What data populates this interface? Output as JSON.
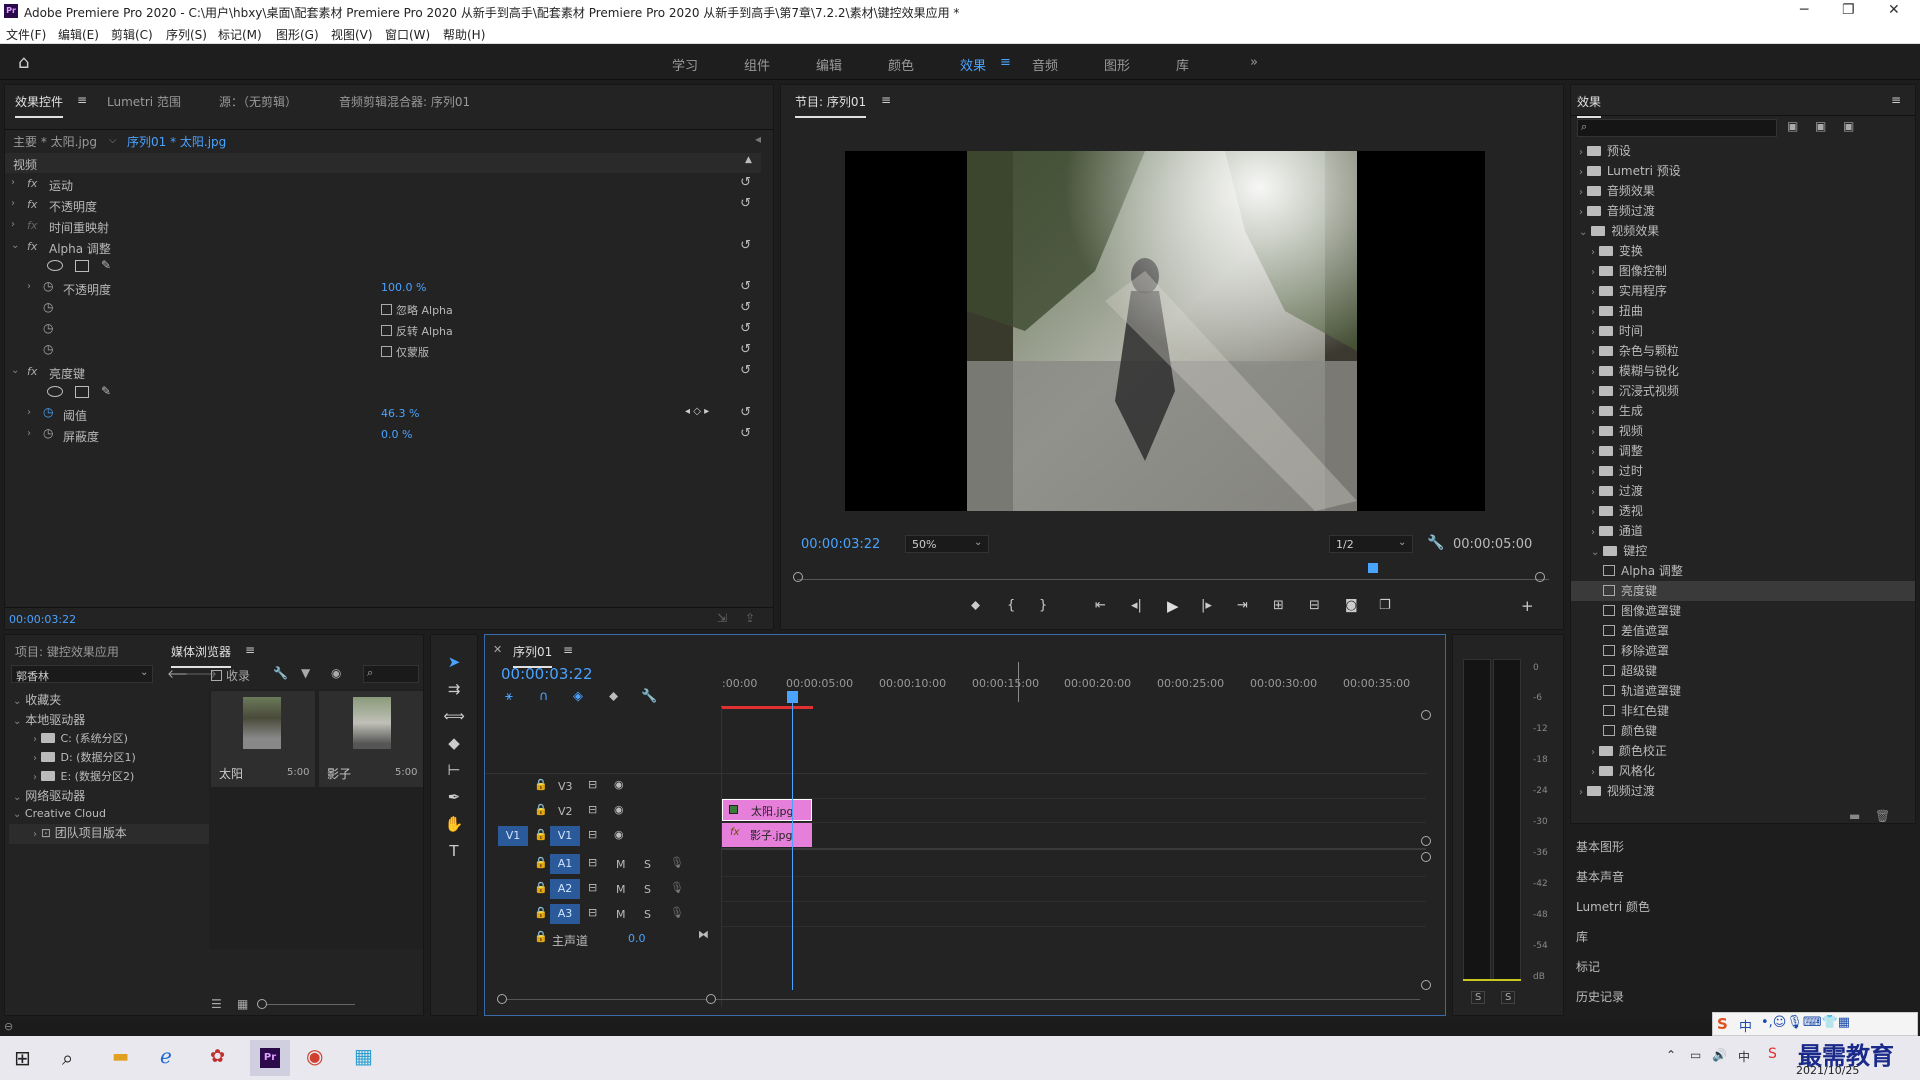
{
  "app": {
    "title": "Adobe Premiere Pro 2020 - C:\\用户\\hbxy\\桌面\\配套素材 Premiere Pro 2020 从新手到高手\\配套素材 Premiere Pro 2020 从新手到高手\\第7章\\7.2.2\\素材\\键控效果应用 *",
    "logo": "Pr"
  },
  "menu": [
    "文件(F)",
    "编辑(E)",
    "剪辑(C)",
    "序列(S)",
    "标记(M)",
    "图形(G)",
    "视图(V)",
    "窗口(W)",
    "帮助(H)"
  ],
  "workspaces": [
    "学习",
    "组件",
    "编辑",
    "颜色",
    "效果",
    "音频",
    "图形",
    "库"
  ],
  "workspace_more": "»",
  "effect_controls": {
    "tabs": [
      "效果控件",
      "Lumetri 范围",
      "源：（无剪辑）",
      "音频剪辑混合器: 序列01"
    ],
    "master": "主要 * 太阳.jpg",
    "sequence": "序列01 * 太阳.jpg",
    "section": "视频",
    "items": {
      "motion": "运动",
      "opacity": "不透明度",
      "time_remap": "时间重映射",
      "alpha_adjust": "Alpha 调整",
      "alpha_opacity": "不透明度",
      "alpha_opacity_val": "100.0 %",
      "ignore_alpha": "忽略 Alpha",
      "invert_alpha": "反转 Alpha",
      "mask_only": "仅蒙版",
      "luma_key": "亮度键",
      "threshold": "阈值",
      "threshold_val": "46.3 %",
      "cutoff": "屏蔽度",
      "cutoff_val": "0.0 %"
    },
    "fx_label": "fx",
    "timecode": "00:00:03:22"
  },
  "program": {
    "title": "节目: 序列01",
    "timecode": "00:00:03:22",
    "zoom": "50%",
    "quality": "1/2",
    "duration": "00:00:05:00"
  },
  "project": {
    "tabs": [
      "项目: 键控效果应用",
      "媒体浏览器"
    ],
    "font_dropdown": "郭香林",
    "ingest": "收录",
    "tree": {
      "favorites": "收藏夹",
      "local": "本地驱动器",
      "c": "C: (系统分区)",
      "d": "D: (数据分区1)",
      "e": "E: (数据分区2)",
      "network": "网络驱动器",
      "cc": "Creative Cloud",
      "team": "团队项目版本"
    },
    "thumbs": [
      {
        "name": "太阳",
        "dur": "5:00"
      },
      {
        "name": "影子",
        "dur": "5:00"
      }
    ]
  },
  "timeline": {
    "title": "序列01",
    "timecode": "00:00:03:22",
    "ruler": [
      ":00:00",
      "00:00:05:00",
      "00:00:10:00",
      "00:00:15:00",
      "00:00:20:00",
      "00:00:25:00",
      "00:00:30:00",
      "00:00:35:00"
    ],
    "tracks": {
      "v3": "V3",
      "v2": "V2",
      "v1": "V1",
      "src_v1": "V1",
      "a1": "A1",
      "a2": "A2",
      "a3": "A3",
      "master": "主声道",
      "master_val": "0.0",
      "m": "M",
      "s": "S"
    },
    "clips": [
      {
        "name": "太阳.jpg",
        "track": "V2"
      },
      {
        "name": "影子.jpg",
        "track": "V1"
      }
    ]
  },
  "meter": {
    "labels": [
      "0",
      "-6",
      "-12",
      "-18",
      "-24",
      "-30",
      "-36",
      "-42",
      "-48",
      "-54",
      "dB"
    ],
    "solo": [
      "S",
      "S"
    ]
  },
  "effects": {
    "title": "效果",
    "search_placeholder": "",
    "items": [
      {
        "label": "预设",
        "level": 0,
        "open": false
      },
      {
        "label": "Lumetri 预设",
        "level": 0,
        "open": false
      },
      {
        "label": "音频效果",
        "level": 0,
        "open": false
      },
      {
        "label": "音频过渡",
        "level": 0,
        "open": false
      },
      {
        "label": "视频效果",
        "level": 0,
        "open": true
      },
      {
        "label": "变换",
        "level": 1,
        "open": false
      },
      {
        "label": "图像控制",
        "level": 1,
        "open": false
      },
      {
        "label": "实用程序",
        "level": 1,
        "open": false
      },
      {
        "label": "扭曲",
        "level": 1,
        "open": false
      },
      {
        "label": "时间",
        "level": 1,
        "open": false
      },
      {
        "label": "杂色与颗粒",
        "level": 1,
        "open": false
      },
      {
        "label": "模糊与锐化",
        "level": 1,
        "open": false
      },
      {
        "label": "沉浸式视频",
        "level": 1,
        "open": false
      },
      {
        "label": "生成",
        "level": 1,
        "open": false
      },
      {
        "label": "视频",
        "level": 1,
        "open": false
      },
      {
        "label": "调整",
        "level": 1,
        "open": false
      },
      {
        "label": "过时",
        "level": 1,
        "open": false
      },
      {
        "label": "过渡",
        "level": 1,
        "open": false
      },
      {
        "label": "透视",
        "level": 1,
        "open": false
      },
      {
        "label": "通道",
        "level": 1,
        "open": false
      },
      {
        "label": "键控",
        "level": 1,
        "open": true
      },
      {
        "label": "Alpha 调整",
        "level": 2,
        "fx": true
      },
      {
        "label": "亮度键",
        "level": 2,
        "fx": true,
        "selected": true
      },
      {
        "label": "图像遮罩键",
        "level": 2,
        "fx": true
      },
      {
        "label": "差值遮罩",
        "level": 2,
        "fx": true
      },
      {
        "label": "移除遮罩",
        "level": 2,
        "fx": true
      },
      {
        "label": "超级键",
        "level": 2,
        "fx": true
      },
      {
        "label": "轨道遮罩键",
        "level": 2,
        "fx": true
      },
      {
        "label": "非红色键",
        "level": 2,
        "fx": true
      },
      {
        "label": "颜色键",
        "level": 2,
        "fx": true
      },
      {
        "label": "颜色校正",
        "level": 1,
        "open": false
      },
      {
        "label": "风格化",
        "level": 1,
        "open": false
      },
      {
        "label": "视频过渡",
        "level": 0,
        "open": false
      }
    ],
    "side_panels": [
      "基本图形",
      "基本声音",
      "Lumetri 颜色",
      "库",
      "标记",
      "历史记录"
    ]
  },
  "taskbar": {
    "date": "2021/10/25",
    "ime": "中",
    "watermark": "最需教育"
  },
  "colors": {
    "accent": "#4aa3ff",
    "clip": "#e67fd9",
    "selection": "#3a3a3a"
  }
}
